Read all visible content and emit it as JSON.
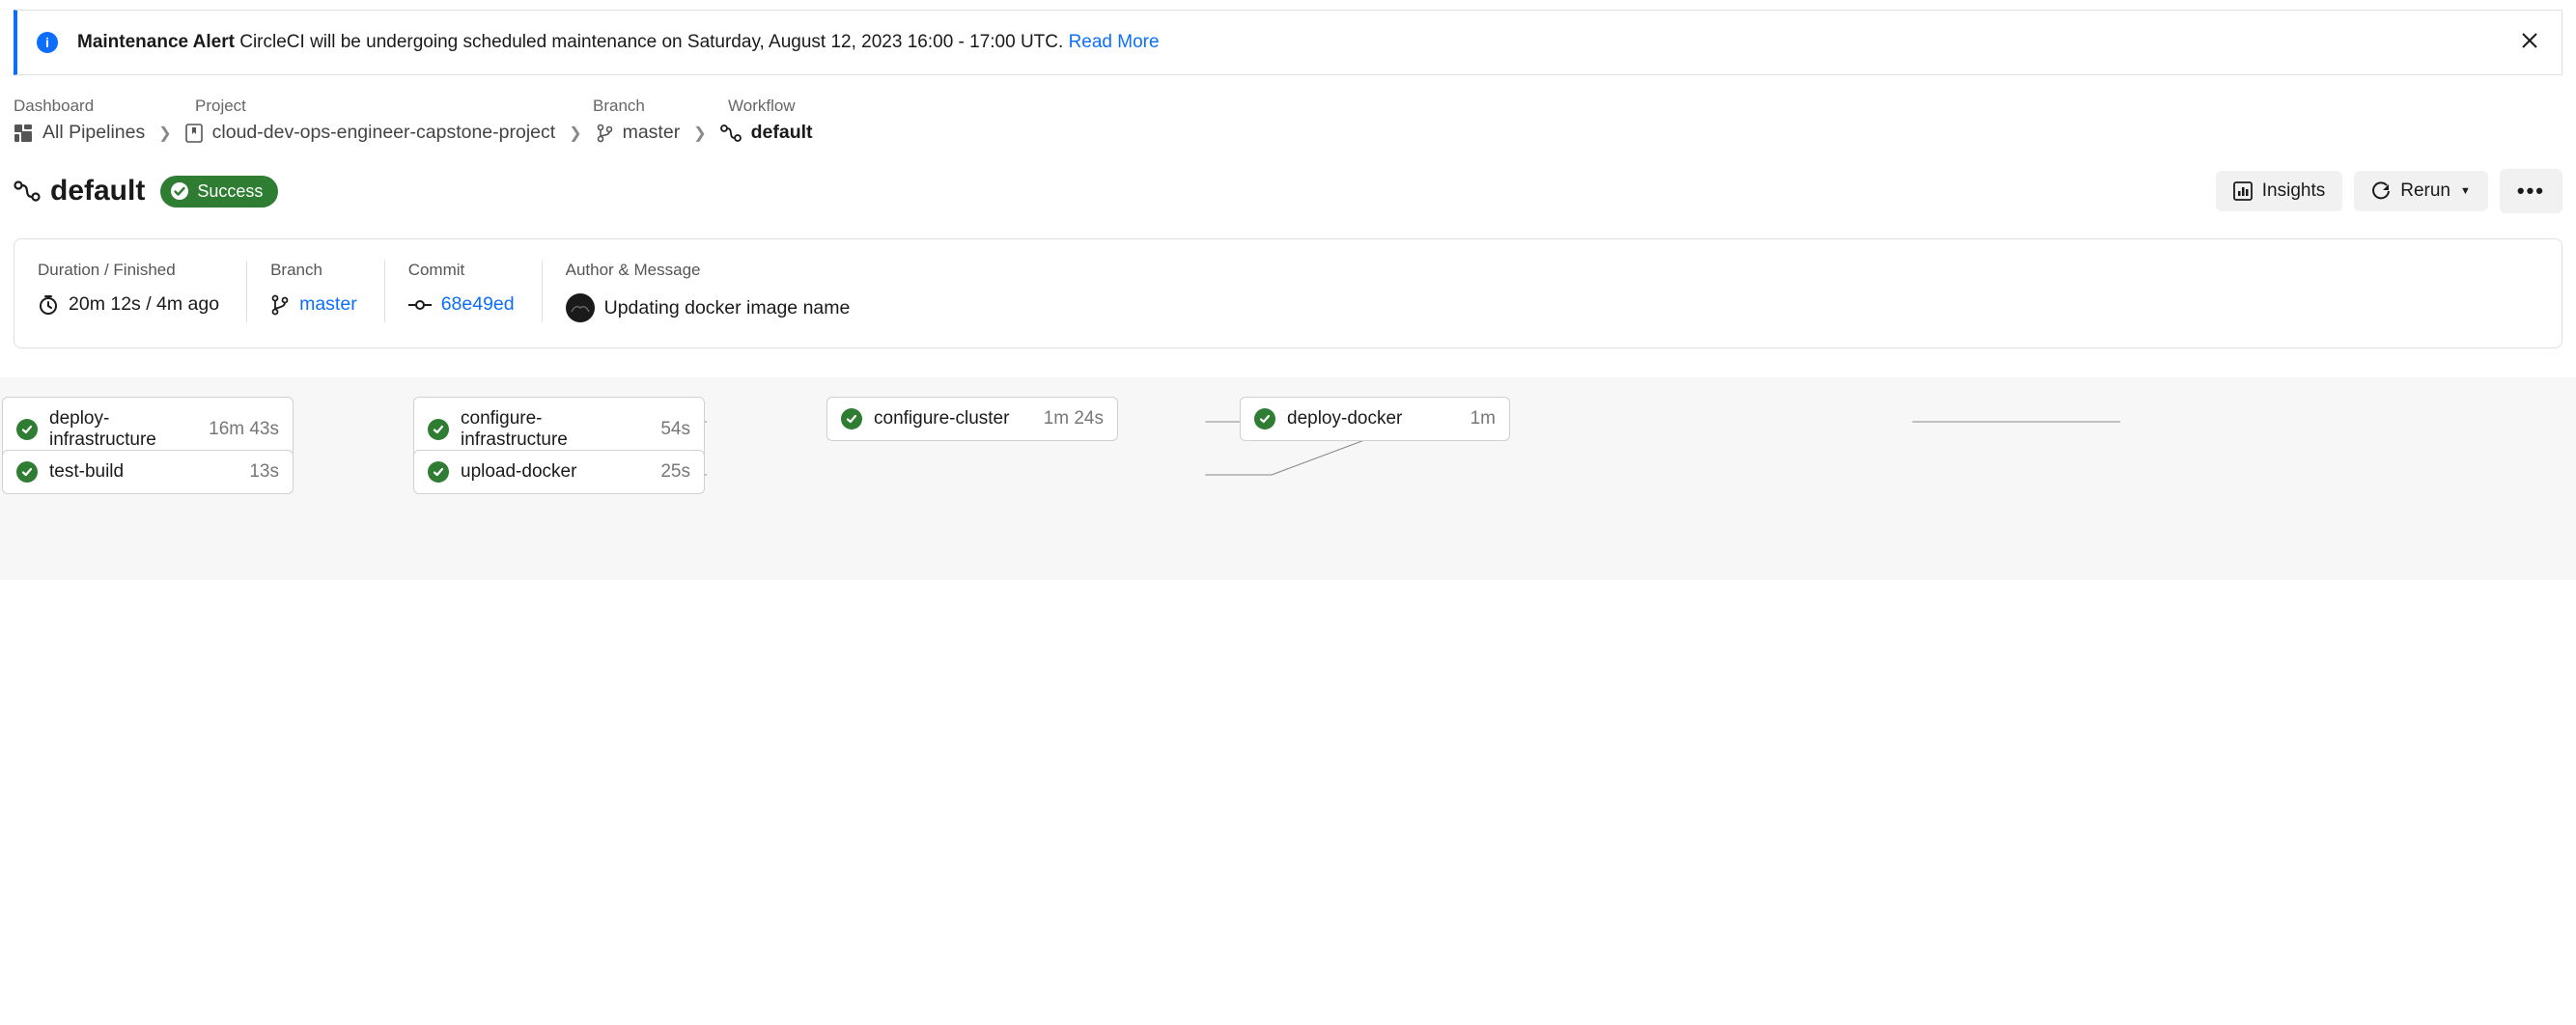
{
  "alert": {
    "bold": "Maintenance Alert",
    "text": " CircleCI will be undergoing scheduled maintenance on Saturday, August 12, 2023 16:00 - 17:00 UTC. ",
    "link": "Read More"
  },
  "breadcrumb": {
    "labels": {
      "l1": "Dashboard",
      "l2": "Project",
      "l3": "Branch",
      "l4": "Workflow"
    },
    "pipelines": "All Pipelines",
    "project": "cloud-dev-ops-engineer-capstone-project",
    "branch": "master",
    "workflow": "default"
  },
  "title": {
    "name": "default",
    "status": "Success",
    "insights": "Insights",
    "rerun": "Rerun"
  },
  "summary": {
    "duration_label": "Duration / Finished",
    "duration_value": "20m 12s / 4m ago",
    "branch_label": "Branch",
    "branch_value": "master",
    "commit_label": "Commit",
    "commit_value": "68e49ed",
    "author_label": "Author & Message",
    "author_message": "Updating docker image name"
  },
  "jobs": {
    "deploy_infrastructure": {
      "name": "deploy-infrastructure",
      "duration": "16m 43s"
    },
    "test_build": {
      "name": "test-build",
      "duration": "13s"
    },
    "configure_infrastructure": {
      "name": "configure-infrastructure",
      "duration": "54s"
    },
    "upload_docker": {
      "name": "upload-docker",
      "duration": "25s"
    },
    "configure_cluster": {
      "name": "configure-cluster",
      "duration": "1m 24s"
    },
    "deploy_docker": {
      "name": "deploy-docker",
      "duration": "1m"
    }
  }
}
